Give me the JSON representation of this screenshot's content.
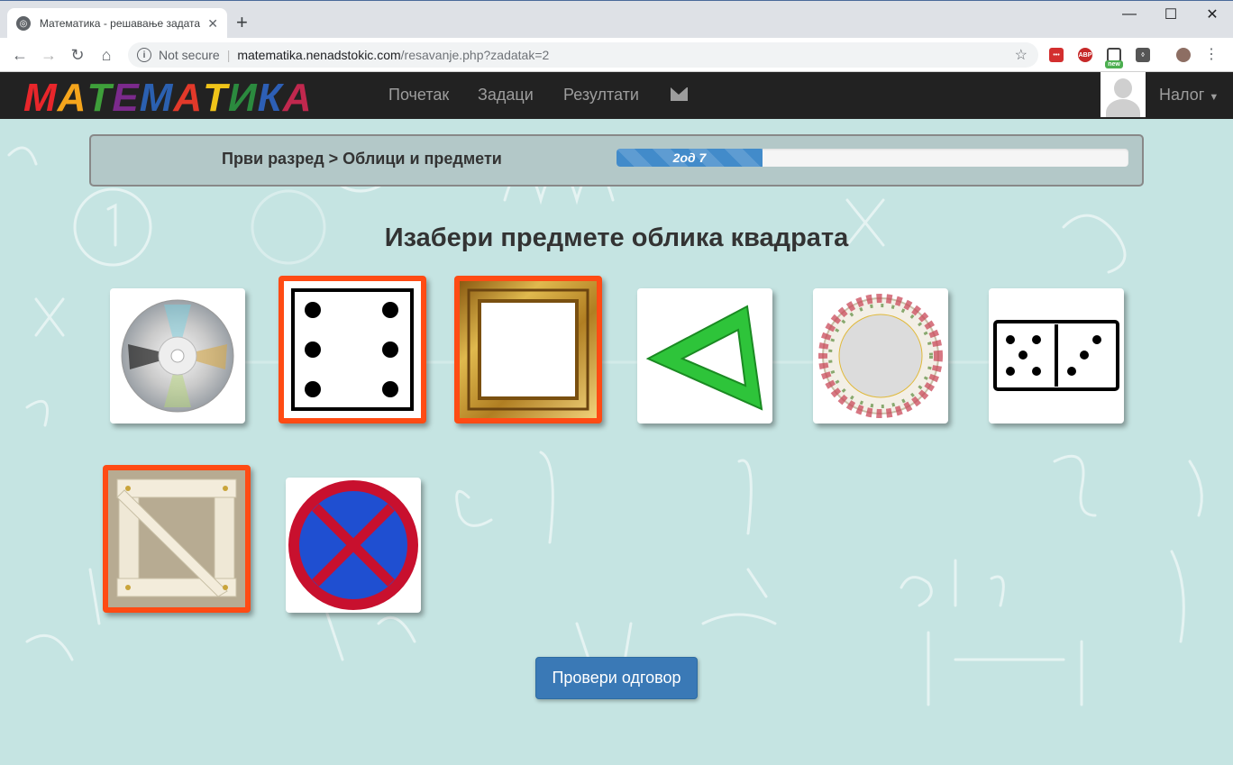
{
  "browser": {
    "tab_title": "Математика - решавање задата",
    "address": {
      "security": "Not secure",
      "host": "matematika.nenadstokic.com",
      "path": "/resavanje.php?zadatak=2"
    },
    "extensions": [
      "lastpass-icon",
      "adblock-icon",
      "screen-capture-icon",
      "bulb-icon",
      "user-profile-icon"
    ],
    "ext_abp": "ABP",
    "ext_new": "new"
  },
  "site": {
    "logo_letters": [
      "М",
      "А",
      "Т",
      "Е",
      "М",
      "А",
      "Т",
      "И",
      "К",
      "А"
    ],
    "logo_colors": [
      "#e8262b",
      "#f5a51c",
      "#3e9f3a",
      "#7b2a8c",
      "#2b60b0",
      "#e2392a",
      "#f0c419",
      "#2b8a3e",
      "#2d5fb5",
      "#c0284e"
    ],
    "nav": {
      "home": "Почетак",
      "tasks": "Задаци",
      "results": "Резултати"
    },
    "account": "Налог"
  },
  "task": {
    "breadcrumb": "Први разред > Облици и предмети",
    "progress_label": "2од 7",
    "progress_fraction": 0.2857,
    "question": "Изабери предмете облика квадрата",
    "items": [
      {
        "name": "cd",
        "selected": false
      },
      {
        "name": "dice-six",
        "selected": true
      },
      {
        "name": "gold-frame",
        "selected": true
      },
      {
        "name": "set-square",
        "selected": false
      },
      {
        "name": "plate",
        "selected": false
      },
      {
        "name": "domino",
        "selected": false
      },
      {
        "name": "wooden-frame",
        "selected": true
      },
      {
        "name": "no-stopping-sign",
        "selected": false
      }
    ],
    "check_button": "Провери одговор"
  },
  "colors": {
    "background": "#c5e4e2",
    "selection_border": "#ff4b14",
    "button": "#3a79b6",
    "navbar": "#222222"
  }
}
